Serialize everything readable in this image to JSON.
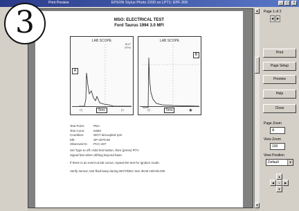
{
  "window": {
    "title": "EPSON Stylus Photo 2200 on LPT1: EPF-209",
    "app_name": "Print Preview",
    "min_label": "_",
    "max_label": "□",
    "close_label": "×"
  },
  "badge": {
    "number": "3"
  },
  "report": {
    "title": "MSO: ELECTRICAL TEST",
    "subtitle": "Ford Taurus 1994 3.0 MFI",
    "scope_left": {
      "label": "LAB SCOPE",
      "readout_1": "BUP",
      "readout_2": "RPM",
      "cursor": "A",
      "key_left": "◁",
      "key_mid": "5ms",
      "key_right": "▷"
    },
    "scope_right": {
      "label": "LAB SCOPE",
      "readout_1": "",
      "readout_2": "",
      "cursor": "B",
      "key_left": "◁",
      "key_mid": "5ms",
      "key_right": "◉"
    },
    "fields": [
      {
        "key": "Test Point:",
        "value": "PDA"
      },
      {
        "key": "Test Conn:",
        "value": "K0E0"
      },
      {
        "key": "Condition:",
        "value": "WOT decoupled rpm"
      },
      {
        "key": "Mfr:",
        "value": "SP-4070-50"
      },
      {
        "key": "Observed D.:",
        "value": "PCC-407"
      }
    ],
    "notes": [
      "Set Type to off; Hold test button, then (press) RTV",
      "Signal fast when drifting beyond base.",
      "If there is an event at lab cursor, repeat the test for ignition mode.",
      "Verify sensor, test fluid lamp during WOT/DEC test. BCM HIGH/LOW."
    ]
  },
  "panel": {
    "pages_label": "Page 1 of 2",
    "pages_prev": "◀",
    "pages_next": "▶",
    "print_button": "Print",
    "page_setup_button": "Page Setup",
    "preview_button": "Preview",
    "help_button": "Help",
    "close_button": "Close",
    "page_zoom_label": "Page Zoom",
    "page_zoom_value": "A",
    "view_zoom_label": "View Zoom",
    "view_zoom_value": "100",
    "view_position_label": "View Position",
    "view_position_value": "Default",
    "pad_up": "▲",
    "pad_left": "◀",
    "pad_center": "•",
    "pad_right": "▶",
    "pad_down": "▼"
  },
  "scrollbar": {
    "up": "▲",
    "down": "▼"
  }
}
